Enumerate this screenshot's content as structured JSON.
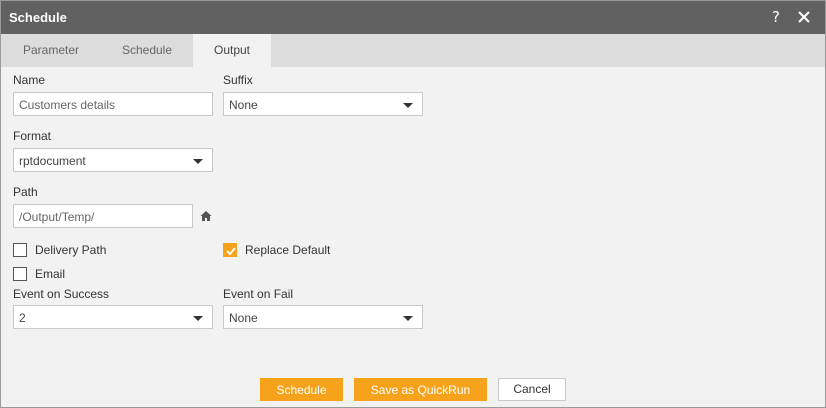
{
  "dialog": {
    "title": "Schedule",
    "help_icon": "question-mark-icon",
    "close_icon": "close-icon"
  },
  "tabs": [
    {
      "label": "Parameter",
      "active": false
    },
    {
      "label": "Schedule",
      "active": false
    },
    {
      "label": "Output",
      "active": true
    }
  ],
  "form": {
    "name": {
      "label": "Name",
      "value": "Customers details"
    },
    "suffix": {
      "label": "Suffix",
      "value": "None"
    },
    "format": {
      "label": "Format",
      "value": "rptdocument"
    },
    "path": {
      "label": "Path",
      "value": "/Output/Temp/",
      "icon": "home-icon"
    },
    "delivery_path": {
      "label": "Delivery Path",
      "checked": false
    },
    "replace_default": {
      "label": "Replace Default",
      "checked": true
    },
    "email": {
      "label": "Email",
      "checked": false
    },
    "event_on_success": {
      "label": "Event on Success",
      "value": "2"
    },
    "event_on_fail": {
      "label": "Event on Fail",
      "value": "None"
    }
  },
  "footer": {
    "schedule_label": "Schedule",
    "quickrun_label": "Save as QuickRun",
    "cancel_label": "Cancel"
  },
  "colors": {
    "accent": "#f7a21b",
    "titlebar": "#616161",
    "tabbar": "#dcdcdc",
    "body": "#f2f2f2"
  }
}
